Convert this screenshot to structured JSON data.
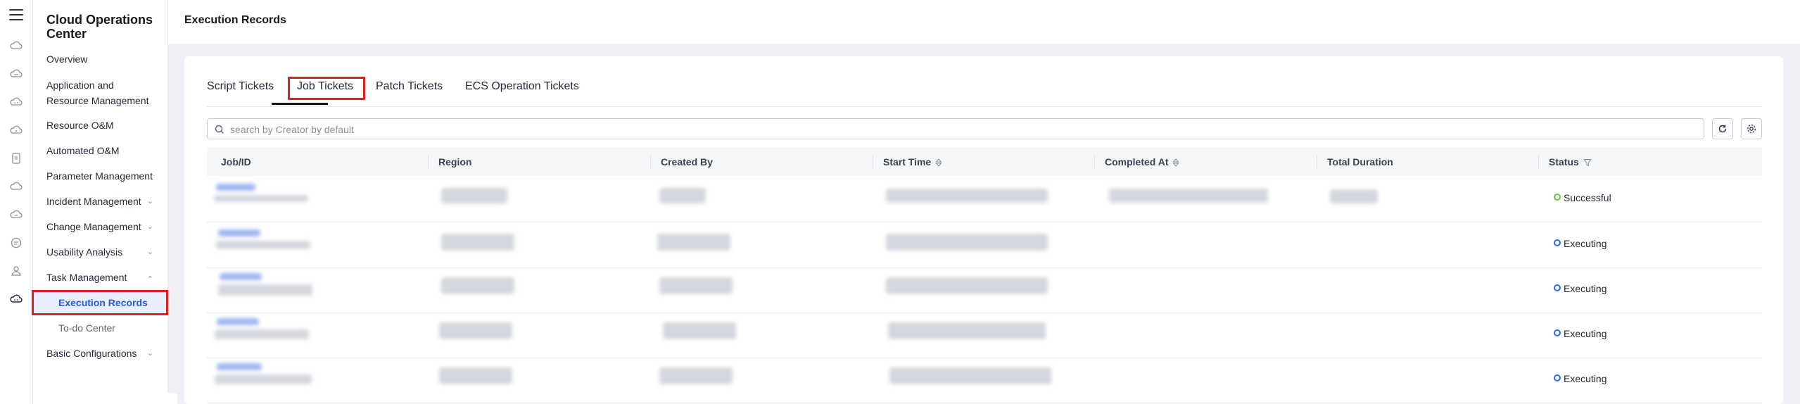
{
  "app": {
    "title": "Cloud Operations Center"
  },
  "nav": {
    "items": [
      {
        "label": "Overview"
      },
      {
        "label": "Application and Resource Management"
      },
      {
        "label": "Resource O&M"
      },
      {
        "label": "Automated O&M"
      },
      {
        "label": "Parameter Management"
      },
      {
        "label": "Incident Management",
        "expandable": true
      },
      {
        "label": "Change Management",
        "expandable": true
      },
      {
        "label": "Usability Analysis",
        "expandable": true
      },
      {
        "label": "Task Management",
        "expandable": true,
        "expanded": true
      },
      {
        "label": "Basic Configurations",
        "expandable": true
      }
    ],
    "sub_items": [
      {
        "label": "Execution Records",
        "active": true
      },
      {
        "label": "To-do Center"
      }
    ]
  },
  "header": {
    "title": "Execution Records"
  },
  "tabs": [
    {
      "label": "Script Tickets"
    },
    {
      "label": "Job Tickets",
      "selected": true
    },
    {
      "label": "Patch Tickets"
    },
    {
      "label": "ECS Operation Tickets"
    }
  ],
  "search": {
    "placeholder": "search by Creator by default",
    "value": ""
  },
  "table": {
    "columns": [
      {
        "label": "Job/ID"
      },
      {
        "label": "Region"
      },
      {
        "label": "Created By"
      },
      {
        "label": "Start Time",
        "sortable": true
      },
      {
        "label": "Completed At",
        "sortable": true
      },
      {
        "label": "Total Duration"
      },
      {
        "label": "Status",
        "filterable": true
      }
    ],
    "rows": [
      {
        "status": "Successful",
        "status_type": "success"
      },
      {
        "status": "Executing",
        "status_type": "running"
      },
      {
        "status": "Executing",
        "status_type": "running"
      },
      {
        "status": "Executing",
        "status_type": "running"
      },
      {
        "status": "Executing",
        "status_type": "running"
      }
    ]
  },
  "colors": {
    "accent": "#2958d8",
    "highlight_box": "#e02020",
    "status_success": "#6fbf40",
    "status_running": "#2e6be6"
  }
}
